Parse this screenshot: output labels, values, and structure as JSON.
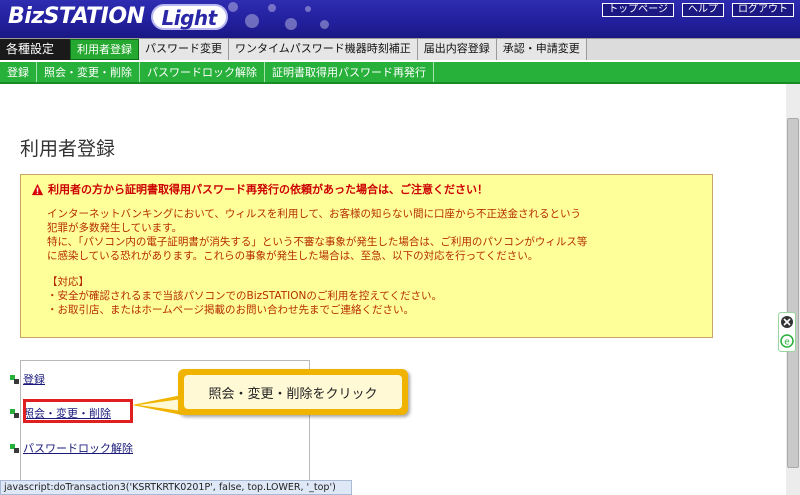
{
  "header": {
    "logo_main": "BizSTATION",
    "logo_sub": "Light",
    "links": [
      "トップページ",
      "ヘルプ",
      "ログアウト"
    ]
  },
  "mainnav": {
    "label": "各種設定",
    "items": [
      "利用者登録",
      "パスワード変更",
      "ワンタイムパスワード機器時刻補正",
      "届出内容登録",
      "承認・申請変更"
    ],
    "active_index": 0
  },
  "subnav": {
    "items": [
      "登録",
      "照会・変更・削除",
      "パスワードロック解除",
      "証明書取得用パスワード再発行"
    ]
  },
  "page": {
    "title": "利用者登録"
  },
  "warning": {
    "heading": "利用者の方から証明書取得用パスワード再発行の依頼があった場合は、ご注意ください！",
    "lines": [
      "インターネットバンキングにおいて、ウィルスを利用して、お客様の知らない間に口座から不正送金されるという",
      "犯罪が多数発生しています。",
      "特に、「パソコン内の電子証明書が消失する」という不審な事象が発生した場合は、ご利用のパソコンがウィルス等",
      "に感染している恐れがあります。これらの事象が発生した場合は、至急、以下の対応を行ってください。"
    ],
    "action_lines": [
      "【対応】",
      "・安全が確認されるまで当該パソコンでのBizSTATIONのご利用を控えてください。",
      "・お取引店、またはホームページ掲載のお問い合わせ先までご連絡ください。"
    ],
    "colors": {
      "background": "#ffff99",
      "text": "#b52c00",
      "heading": "#cc0000"
    }
  },
  "menu": {
    "links": [
      "登録",
      "照会・変更・削除",
      "パスワードロック解除"
    ]
  },
  "callout": {
    "text": "照会・変更・削除をクリック"
  },
  "statusbar": {
    "text": "javascript:doTransaction3('KSRTKRTK0201P', false, top.LOWER, '_top')"
  },
  "colors": {
    "header_bg": "#221f9c",
    "subnav_bg": "#27b03a",
    "active_tab": "#25a82f",
    "highlight_box": "#e02020",
    "callout_border": "#f0b400"
  }
}
